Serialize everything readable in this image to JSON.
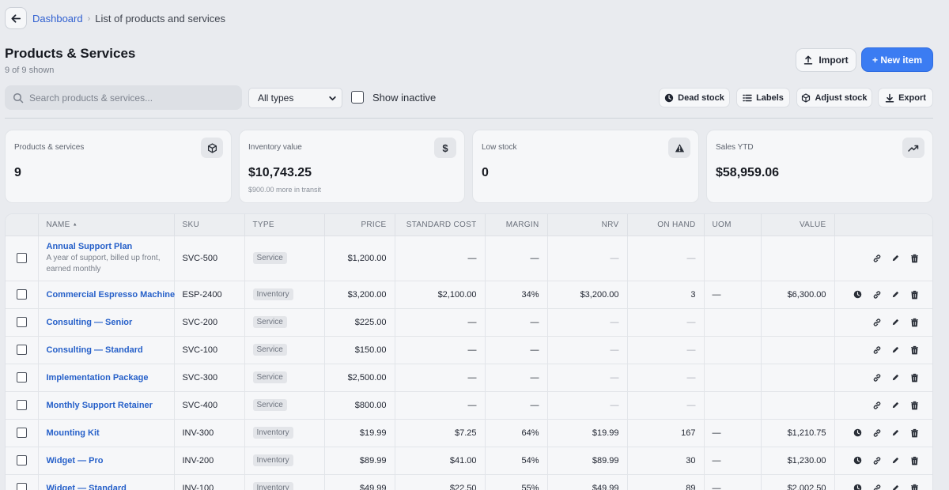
{
  "breadcrumb": {
    "home": "Dashboard",
    "current": "List of products and services"
  },
  "page": {
    "title": "Products & Services",
    "shown": "9 of 9 shown"
  },
  "header_actions": {
    "import": "Import",
    "new_item": "+ New item"
  },
  "filters": {
    "search_placeholder": "Search products & services...",
    "type_selected": "All types",
    "show_inactive": "Show inactive"
  },
  "tools": {
    "dead_stock": "Dead stock",
    "labels": "Labels",
    "adjust_stock": "Adjust stock",
    "export": "Export"
  },
  "cards": [
    {
      "label": "Products & services",
      "value": "9",
      "sub": "",
      "icon": "cube-icon"
    },
    {
      "label": "Inventory value",
      "value": "$10,743.25",
      "sub": "$900.00 more in transit",
      "icon": "dollar-icon"
    },
    {
      "label": "Low stock",
      "value": "0",
      "sub": "",
      "icon": "warning-icon"
    },
    {
      "label": "Sales YTD",
      "value": "$58,959.06",
      "sub": "",
      "icon": "trending-up-icon"
    }
  ],
  "table": {
    "headers": {
      "name": "NAME",
      "sort_indicator": "▲",
      "sku": "SKU",
      "type": "TYPE",
      "price": "PRICE",
      "standard_cost": "STANDARD COST",
      "margin": "MARGIN",
      "nrv": "NRV",
      "on_hand": "ON HAND",
      "uom": "UOM",
      "value": "VALUE"
    },
    "rows": [
      {
        "name": "Annual Support Plan",
        "desc": "A year of support, billed up front, earned monthly",
        "sku": "SVC-500",
        "type": "Service",
        "price": "$1,200.00",
        "cost": "—",
        "margin": "—",
        "nrv": "—",
        "on_hand": "—",
        "uom": "",
        "value": ""
      },
      {
        "name": "Commercial Espresso Machine",
        "desc": "",
        "sku": "ESP-2400",
        "type": "Inventory",
        "price": "$3,200.00",
        "cost": "$2,100.00",
        "margin": "34%",
        "nrv": "$3,200.00",
        "on_hand": "3",
        "uom": "—",
        "value": "$6,300.00"
      },
      {
        "name": "Consulting — Senior",
        "desc": "",
        "sku": "SVC-200",
        "type": "Service",
        "price": "$225.00",
        "cost": "—",
        "margin": "—",
        "nrv": "—",
        "on_hand": "—",
        "uom": "",
        "value": ""
      },
      {
        "name": "Consulting — Standard",
        "desc": "",
        "sku": "SVC-100",
        "type": "Service",
        "price": "$150.00",
        "cost": "—",
        "margin": "—",
        "nrv": "—",
        "on_hand": "—",
        "uom": "",
        "value": ""
      },
      {
        "name": "Implementation Package",
        "desc": "",
        "sku": "SVC-300",
        "type": "Service",
        "price": "$2,500.00",
        "cost": "—",
        "margin": "—",
        "nrv": "—",
        "on_hand": "—",
        "uom": "",
        "value": ""
      },
      {
        "name": "Monthly Support Retainer",
        "desc": "",
        "sku": "SVC-400",
        "type": "Service",
        "price": "$800.00",
        "cost": "—",
        "margin": "—",
        "nrv": "—",
        "on_hand": "—",
        "uom": "",
        "value": ""
      },
      {
        "name": "Mounting Kit",
        "desc": "",
        "sku": "INV-300",
        "type": "Inventory",
        "price": "$19.99",
        "cost": "$7.25",
        "margin": "64%",
        "nrv": "$19.99",
        "on_hand": "167",
        "uom": "—",
        "value": "$1,210.75"
      },
      {
        "name": "Widget — Pro",
        "desc": "",
        "sku": "INV-200",
        "type": "Inventory",
        "price": "$89.99",
        "cost": "$41.00",
        "margin": "54%",
        "nrv": "$89.99",
        "on_hand": "30",
        "uom": "—",
        "value": "$1,230.00"
      },
      {
        "name": "Widget — Standard",
        "desc": "",
        "sku": "INV-100",
        "type": "Inventory",
        "price": "$49.99",
        "cost": "$22.50",
        "margin": "55%",
        "nrv": "$49.99",
        "on_hand": "89",
        "uom": "—",
        "value": "$2,002.50"
      }
    ]
  }
}
